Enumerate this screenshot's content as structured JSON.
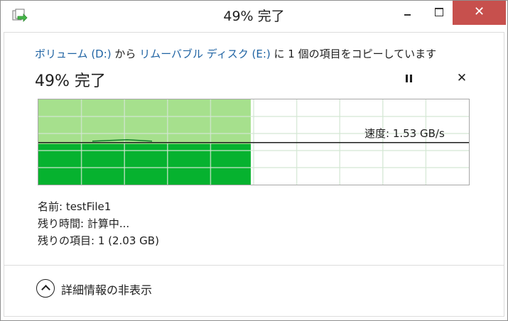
{
  "window": {
    "title": "49% 完了",
    "controls": {
      "minimize": "–",
      "maximize": "□",
      "close": "✕"
    }
  },
  "copy": {
    "description": {
      "source": "ボリューム (D:)",
      "from": " から ",
      "destination": "リムーバブル ディスク (E:)",
      "rest": " に 1 個の項目をコピーしています"
    },
    "progress_text": "49% 完了",
    "progress_percent": 49,
    "pause_label": "❚❚",
    "cancel_label": "✕",
    "speed_label": "速度: 1.53 GB/s",
    "speed_fraction": 0.51
  },
  "details": {
    "name": "名前: testFile1",
    "time_remaining": "残り時間: 計算中...",
    "items_remaining": "残りの項目: 1 (2.03 GB)"
  },
  "toggle": {
    "label": "詳細情報の非表示"
  },
  "colors": {
    "progress_fill": "#a6e08d",
    "speed_fill": "#06b22f",
    "grid_line": "#d3e7d3",
    "link": "#1f63a3",
    "close_button": "#c7504d"
  },
  "icons": {
    "app": "copy-files-icon",
    "pause": "pause-icon",
    "cancel": "close-icon",
    "toggle": "chevron-up-icon"
  }
}
